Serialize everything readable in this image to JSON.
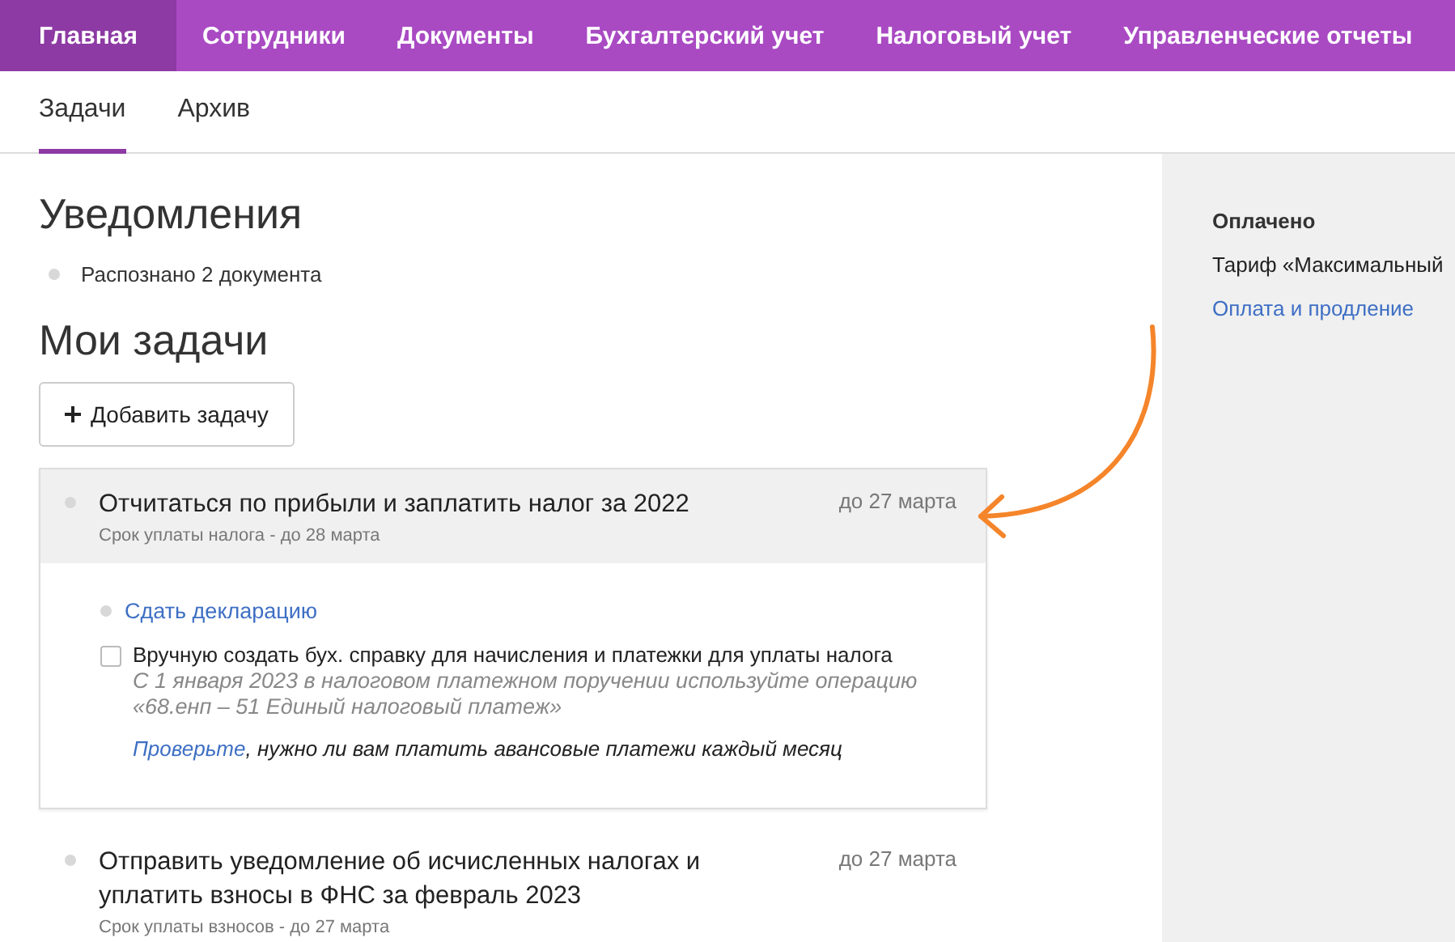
{
  "nav": [
    {
      "label": "Главная",
      "selected": true
    },
    {
      "label": "Сотрудники",
      "selected": false
    },
    {
      "label": "Документы",
      "selected": false
    },
    {
      "label": "Бухгалтерский учет",
      "selected": false
    },
    {
      "label": "Налоговый учет",
      "selected": false
    },
    {
      "label": "Управленческие отчеты",
      "selected": false
    }
  ],
  "tabs": [
    {
      "label": "Задачи",
      "selected": true
    },
    {
      "label": "Архив",
      "selected": false
    }
  ],
  "notifications": {
    "title": "Уведомления",
    "items": [
      "Распознано 2 документа"
    ]
  },
  "tasks_section": {
    "title": "Мои задачи",
    "add_button": "Добавить задачу"
  },
  "tasks": [
    {
      "title": "Отчитаться по прибыли и заплатить налог за 2022",
      "subtitle": "Срок уплаты налога - до 28 марта",
      "due": "до 27 марта",
      "expanded": true,
      "subtasks": [
        {
          "kind": "link",
          "label": "Сдать декларацию"
        },
        {
          "kind": "checkbox",
          "label": "Вручную создать бух. справку для начисления и платежки для уплаты налога",
          "checked": false,
          "note": "С 1 января 2023 в налоговом платежном поручении используйте операцию «68.енп – 51 Единый налоговый платеж»",
          "hint_link": "Проверьте",
          "hint_text": ", нужно ли вам платить авансовые платежи каждый месяц"
        }
      ]
    },
    {
      "title": "Отправить уведомление об исчисленных налогах и уплатить взносы в ФНС за февраль 2023",
      "subtitle": "Срок уплаты взносов - до 27 марта",
      "due": "до 27 марта",
      "expanded": false
    }
  ],
  "sidebar": {
    "title": "Оплачено",
    "tariff": "Тариф «Максимальный",
    "link": "Оплата и продление"
  }
}
